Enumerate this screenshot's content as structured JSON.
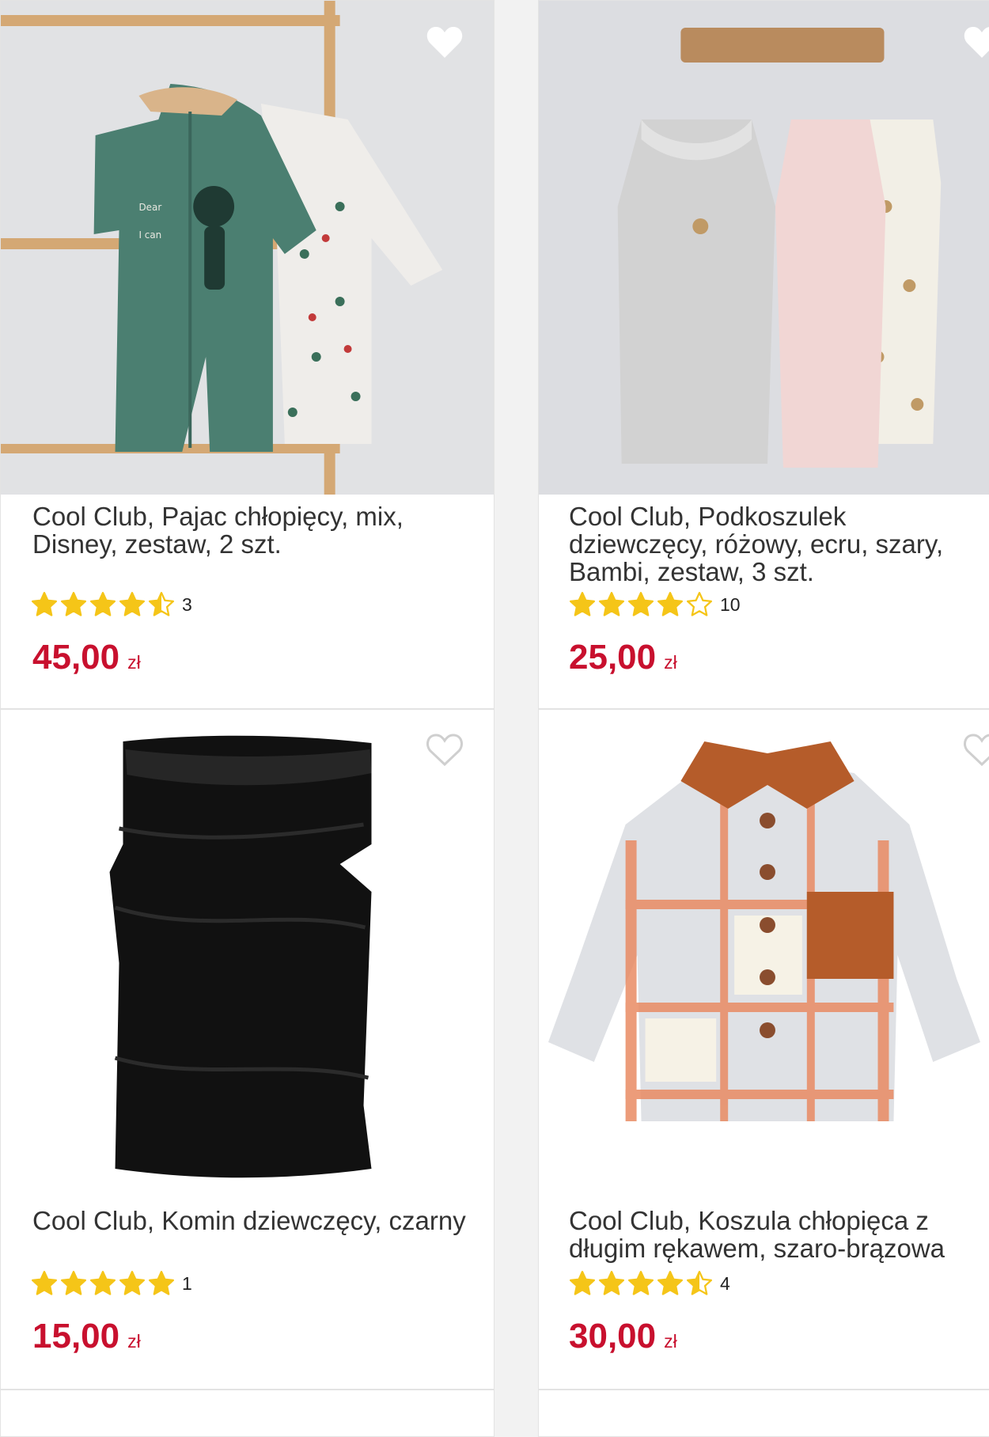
{
  "products": [
    {
      "title": "Cool Club, Pajac chłopięcy, mix, Disney, zestaw, 2 szt.",
      "rating": 4.5,
      "reviews": "3",
      "price": "45,00",
      "currency": "zł",
      "favorite_icon": "heart-icon",
      "favorited_style": "filled-white"
    },
    {
      "title": "Cool Club, Podkoszulek dziewczęcy, różowy, ecru, szary, Bambi, zestaw, 3 szt.",
      "rating": 4,
      "reviews": "10",
      "price": "25,00",
      "currency": "zł",
      "favorite_icon": "heart-icon",
      "favorited_style": "filled-white"
    },
    {
      "title": "Cool Club, Komin dziewczęcy, czarny",
      "rating": 5,
      "reviews": "1",
      "price": "15,00",
      "currency": "zł",
      "favorite_icon": "heart-icon",
      "favorited_style": "outline"
    },
    {
      "title": "Cool Club, Koszula chłopięca z długim rękawem, szaro-brązowa",
      "rating": 4.5,
      "reviews": "4",
      "price": "30,00",
      "currency": "zł",
      "favorite_icon": "heart-icon",
      "favorited_style": "outline"
    }
  ],
  "colors": {
    "price": "#c8102e",
    "star": "#f5c518",
    "text": "#333333"
  }
}
